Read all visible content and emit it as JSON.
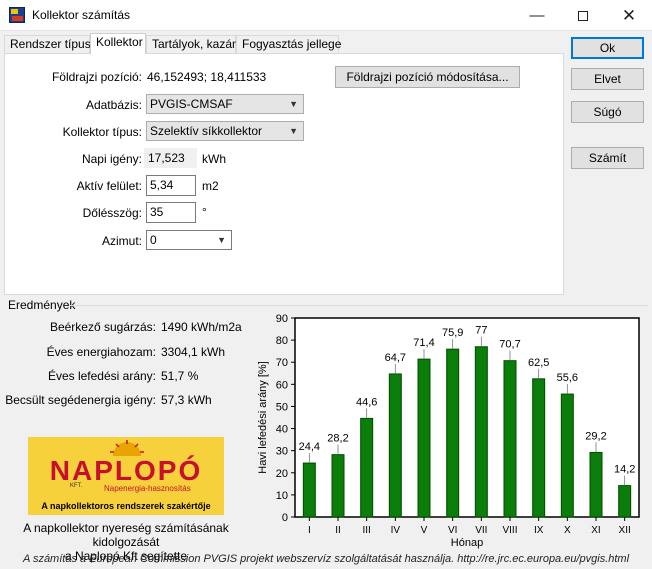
{
  "window": {
    "title": "Kollektor számítás",
    "minimize_glyph": "—",
    "close_glyph": "✕"
  },
  "tabs": [
    {
      "label": "Rendszer típusa",
      "active": false
    },
    {
      "label": "Kollektor",
      "active": true
    },
    {
      "label": "Tartályok, kazán",
      "active": false
    },
    {
      "label": "Fogyasztás jellege",
      "active": false
    }
  ],
  "form": {
    "geo_label": "Földrajzi pozíció:",
    "geo_value": "46,152493; 18,411533",
    "geo_button": "Földrajzi pozíció módosítása...",
    "database_label": "Adatbázis:",
    "database_value": "PVGIS-CMSAF",
    "collector_type_label": "Kollektor típus:",
    "collector_type_value": "Szelektív síkkollektor",
    "daily_need_label": "Napi igény:",
    "daily_need_value": "17,523",
    "daily_need_unit": "kWh",
    "active_surface_label": "Aktív felület:",
    "active_surface_value": "5,34",
    "active_surface_unit": "m2",
    "tilt_label": "Dőlésszög:",
    "tilt_value": "35",
    "tilt_unit": "°",
    "azimuth_label": "Azimut:",
    "azimuth_value": "0"
  },
  "side_buttons": {
    "ok": "Ok",
    "cancel": "Elvet",
    "help": "Súgó",
    "calculate": "Számít"
  },
  "results": {
    "title": "Eredmények",
    "rows": [
      {
        "label": "Beérkező sugárzás:",
        "value": "1490 kWh/m2a"
      },
      {
        "label": "Éves energiahozam:",
        "value": "3304,1 kWh"
      },
      {
        "label": "Éves lefedési arány:",
        "value": "51,7 %"
      },
      {
        "label": "Becsült segédenergia igény:",
        "value": "57,3 kWh"
      }
    ]
  },
  "logo": {
    "brand": "NAPLOPÓ",
    "kft": "KFT.",
    "subtitle": "Napenergia-hasznosítás",
    "slogan": "A napkollektoros rendszerek szakértője"
  },
  "credits": {
    "line1": "A napkollektor nyereség számításának kidolgozását",
    "line2": "a Naplopó Kft segítette"
  },
  "footer": "A számítás a European Commission PVGIS projekt webszervíz szolgáltatását használja. http://re.jrc.ec.europa.eu/pvgis.html",
  "colors": {
    "bar_fill": "#0a7d0a",
    "bar_stroke": "#004d00",
    "accent": "#0078d7",
    "logo_bg": "#f7d13c",
    "logo_red": "#c8102e"
  },
  "chart_data": {
    "type": "bar",
    "categories": [
      "I",
      "II",
      "III",
      "IV",
      "V",
      "VI",
      "VII",
      "VIII",
      "IX",
      "X",
      "XI",
      "XII"
    ],
    "values": [
      24.4,
      28.2,
      44.6,
      64.7,
      71.4,
      75.9,
      77,
      70.7,
      62.5,
      55.6,
      29.2,
      14.2
    ],
    "value_labels": [
      "24,4",
      "28,2",
      "44,6",
      "64,7",
      "71,4",
      "75,9",
      "77",
      "70,7",
      "62,5",
      "55,6",
      "29,2",
      "14,2"
    ],
    "xlabel": "Hónap",
    "ylabel": "Havi lefedési arány [%]",
    "ylim": [
      0,
      90
    ],
    "yticks": [
      0,
      10,
      20,
      30,
      40,
      50,
      60,
      70,
      80,
      90
    ],
    "grid": false,
    "legend": "none"
  }
}
